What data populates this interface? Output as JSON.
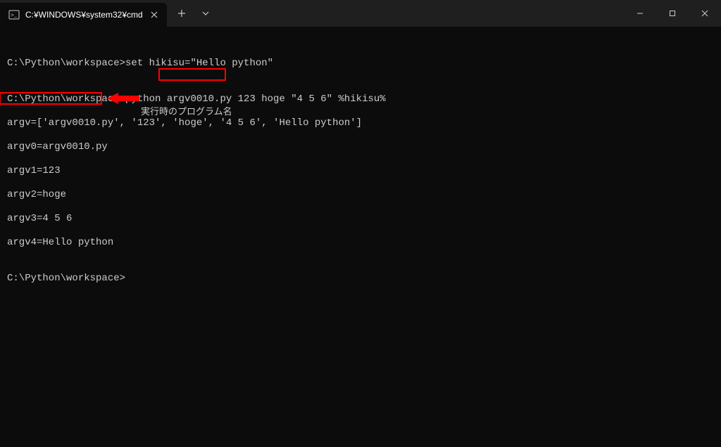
{
  "titlebar": {
    "tab_title": "C:¥WINDOWS¥system32¥cmd"
  },
  "terminal": {
    "lines": [
      "",
      "C:\\Python\\workspace>set hikisu=\"Hello python\"",
      "",
      "C:\\Python\\workspace>python argv0010.py 123 hoge \"4 5 6\" %hikisu%",
      "argv=['argv0010.py', '123', 'hoge', '4 5 6', 'Hello python']",
      "argv0=argv0010.py",
      "argv1=123",
      "argv2=hoge",
      "argv3=4 5 6",
      "argv4=Hello python",
      "",
      "C:\\Python\\workspace>"
    ]
  },
  "annotations": {
    "label1": "実行時のプログラム名"
  }
}
